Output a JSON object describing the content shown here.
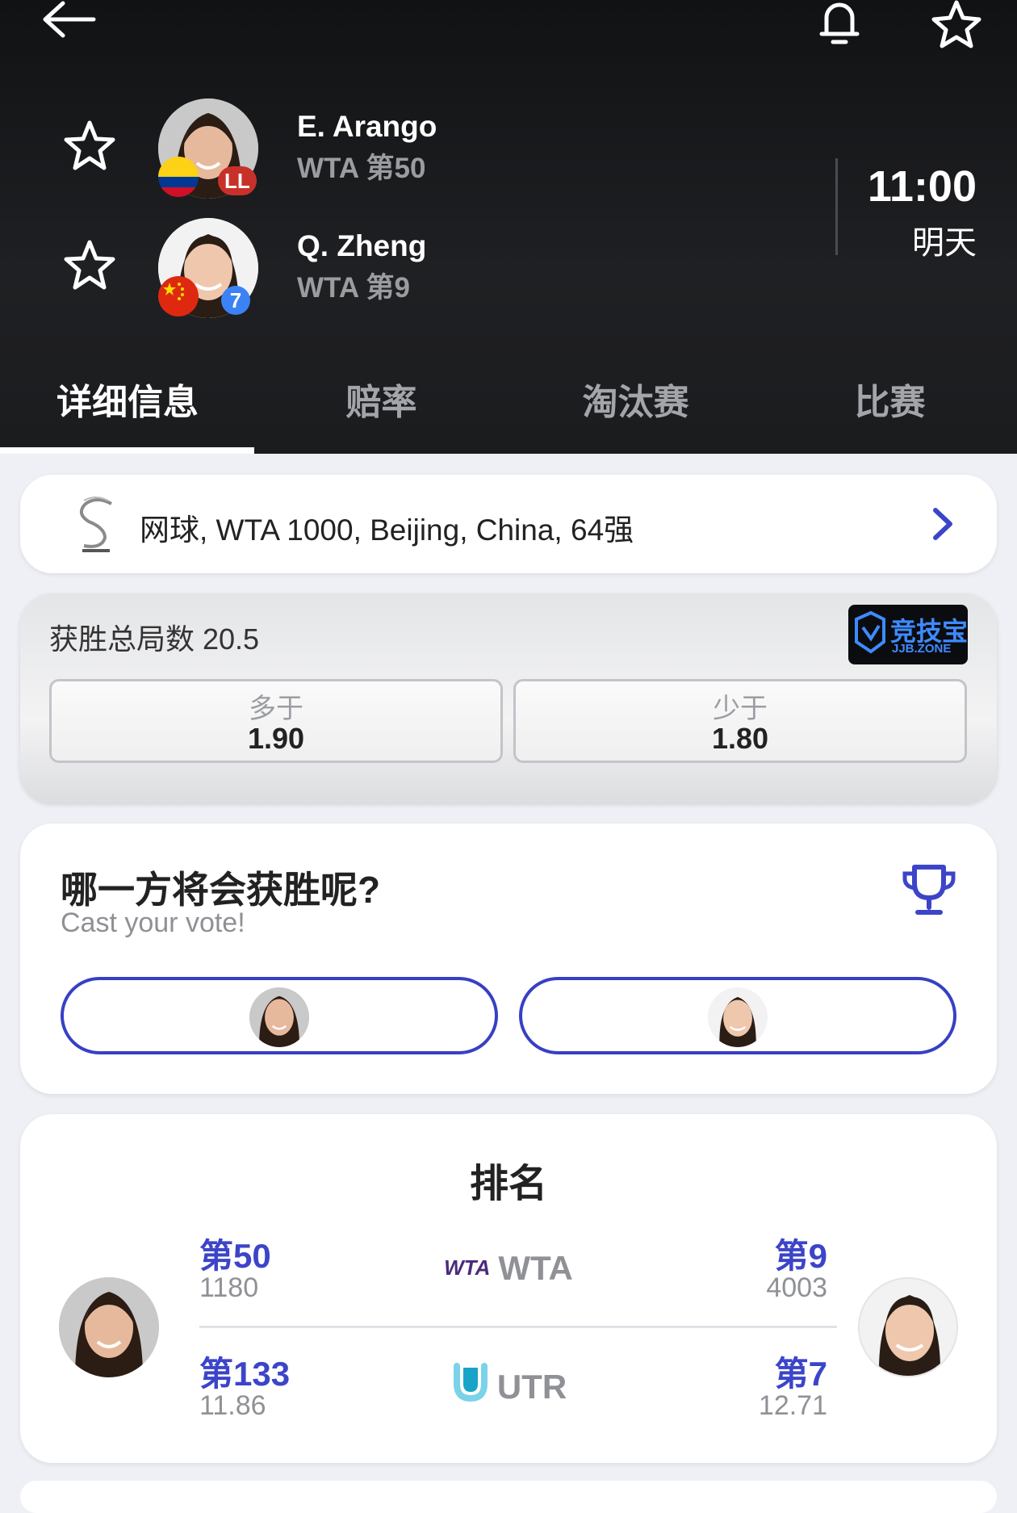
{
  "header": {
    "back_icon": "back-arrow-icon",
    "bell_icon": "bell-icon",
    "favorite_icon": "star-outline-icon",
    "players": [
      {
        "name": "E. Arango",
        "rank": "WTA 第50",
        "badge": "LL",
        "badge_color": "#c8312a",
        "flag": "Colombia"
      },
      {
        "name": "Q. Zheng",
        "rank": "WTA 第9",
        "badge": "7",
        "badge_color": "#3b82f6",
        "flag": "China"
      }
    ],
    "time": "11:00",
    "day": "明天"
  },
  "tabs": [
    {
      "label": "详细信息",
      "active": true
    },
    {
      "label": "赔率",
      "active": false
    },
    {
      "label": "淘汰赛",
      "active": false
    },
    {
      "label": "比赛",
      "active": false
    }
  ],
  "tournament": {
    "text": "网球, WTA 1000, Beijing, China, 64强"
  },
  "odds": {
    "title": "获胜总局数 20.5",
    "sponsor_text": "竞技宝",
    "sponsor_sub": "JJB.ZONE",
    "options": [
      {
        "label": "多于",
        "value": "1.90"
      },
      {
        "label": "少于",
        "value": "1.80"
      }
    ]
  },
  "vote": {
    "title": "哪一方将会获胜呢?",
    "subtitle": "Cast your vote!"
  },
  "ranking": {
    "title": "排名",
    "rows": [
      {
        "org": "WTA",
        "logo_text": "WTA",
        "left_rank": "第50",
        "left_points": "1180",
        "right_rank": "第9",
        "right_points": "4003"
      },
      {
        "org": "UTR",
        "left_rank": "第133",
        "left_points": "11.86",
        "right_rank": "第7",
        "right_points": "12.71"
      }
    ]
  },
  "colors": {
    "accent": "#3c45c8",
    "header_bg": "#1b1c1e"
  }
}
